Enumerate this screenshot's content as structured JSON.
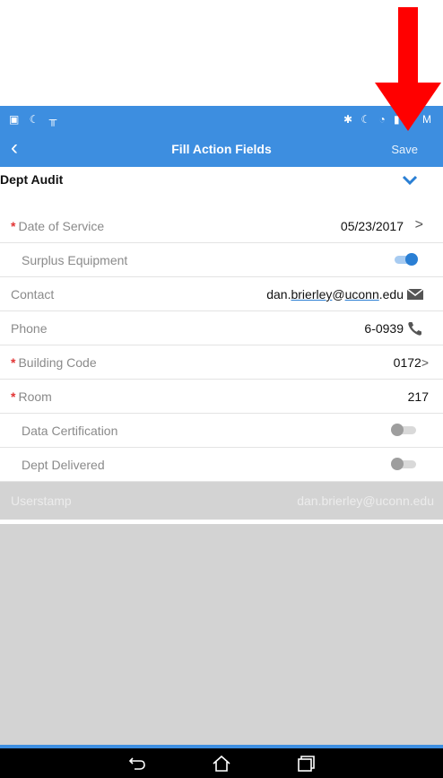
{
  "status_bar": {
    "left_icons": [
      "image-icon",
      "moon-icon",
      "notification-icon"
    ],
    "right_icons": [
      "bluetooth-icon",
      "moon-icon",
      "wifi-icon",
      "battery-icon"
    ],
    "left_glyphs": "▣ ☾ ╥",
    "right_glyphs": "✱ ☾ ◔ ▮",
    "time": "1 M"
  },
  "app_bar": {
    "back_glyph": "‹",
    "title": "Fill Action Fields",
    "save_label": "Save"
  },
  "section": {
    "title": "Dept Audit",
    "chevron": "chevron-down-icon"
  },
  "form": {
    "required_mark": "*",
    "rows": [
      {
        "label": "Date of Service",
        "value": "05/23/2017",
        "chevron": ">"
      },
      {
        "label": "Surplus Equipment",
        "toggle": "on"
      },
      {
        "label": "Contact",
        "value_parts": [
          "dan.",
          "brierley",
          "@",
          "uconn",
          ".edu"
        ]
      },
      {
        "label": "Phone",
        "value": "6-0939"
      },
      {
        "label": "Building Code",
        "value": "0172",
        "chevron": ">"
      },
      {
        "label": "Room",
        "value": "217"
      },
      {
        "label": "Data Certification",
        "toggle": "off"
      },
      {
        "label": "Dept Delivered",
        "toggle": "off"
      }
    ],
    "userstamp": {
      "label": "Userstamp",
      "value": "dan.brierley@uconn.edu"
    }
  },
  "colors": {
    "accent": "#3d8ee0",
    "required": "#e23434",
    "annotation_arrow": "#ff0000"
  },
  "nav_bar": {
    "buttons": [
      "back-icon",
      "home-icon",
      "recents-icon"
    ]
  }
}
